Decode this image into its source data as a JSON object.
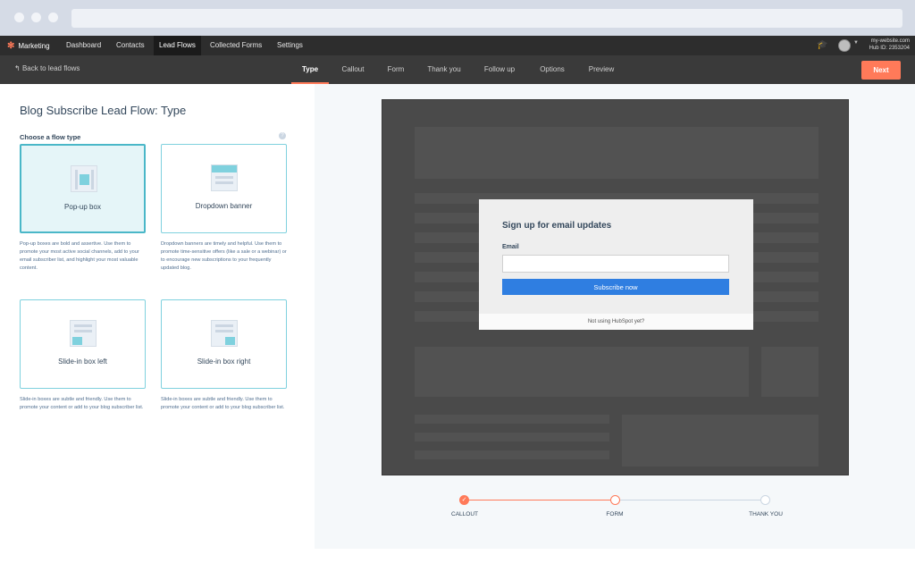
{
  "topnav": {
    "brand": "Marketing",
    "items": [
      "Dashboard",
      "Contacts",
      "Lead Flows",
      "Collected Forms",
      "Settings"
    ],
    "account_site": "my-website.com",
    "account_hub": "Hub ID: 2353204"
  },
  "subnav": {
    "back": "Back to lead flows",
    "steps": [
      "Type",
      "Callout",
      "Form",
      "Thank you",
      "Follow up",
      "Options",
      "Preview"
    ],
    "next": "Next"
  },
  "left": {
    "title": "Blog Subscribe Lead Flow: Type",
    "choose_label": "Choose a flow type",
    "cards": [
      {
        "label": "Pop-up box",
        "desc": "Pop-up boxes are bold and assertive. Use them to promote your most active social channels, add to your email subscriber list, and highlight your most valuable content."
      },
      {
        "label": "Dropdown banner",
        "desc": "Dropdown banners are timely and helpful. Use them to promote time-sensitive offers (like a sale or a webinar) or to encourage new subscriptions to your frequently updated blog."
      },
      {
        "label": "Slide-in box left",
        "desc": "Slide-in boxes are subtle and friendly. Use them to promote your content or add to your blog subscriber list."
      },
      {
        "label": "Slide-in box right",
        "desc": "Slide-in boxes are subtle and friendly. Use them to promote your content or add to your blog subscriber list."
      }
    ]
  },
  "preview": {
    "modal_title": "Sign up for email updates",
    "email_label": "Email",
    "email_value": "",
    "subscribe": "Subscribe now",
    "footer": "Not using HubSpot yet?"
  },
  "progress": {
    "steps": [
      "CALLOUT",
      "FORM",
      "THANK YOU"
    ]
  },
  "colors": {
    "accent": "#ff7a59",
    "teal": "#4ab7c8",
    "button_blue": "#2f7ee1"
  }
}
